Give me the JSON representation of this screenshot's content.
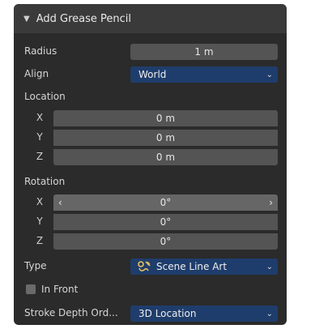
{
  "panel": {
    "title": "Add Grease Pencil",
    "collapse_glyph": "▼"
  },
  "radius": {
    "label": "Radius",
    "value": "1 m"
  },
  "align": {
    "label": "Align",
    "value": "World"
  },
  "location": {
    "label": "Location",
    "x_label": "X",
    "x_value": "0 m",
    "y_label": "Y",
    "y_value": "0 m",
    "z_label": "Z",
    "z_value": "0 m"
  },
  "rotation": {
    "label": "Rotation",
    "x_label": "X",
    "x_value": "0°",
    "y_label": "Y",
    "y_value": "0°",
    "z_label": "Z",
    "z_value": "0°",
    "left_arrow": "‹",
    "right_arrow": "›"
  },
  "type": {
    "label": "Type",
    "value": "Scene Line Art",
    "icon": "grease-pencil-line-art-icon"
  },
  "in_front": {
    "label": "In Front",
    "checked": false
  },
  "stroke_depth": {
    "label": "Stroke Depth Ord...",
    "value": "3D Location"
  },
  "glyphs": {
    "chevron": "⌄"
  },
  "colors": {
    "panel_bg": "#2b2b2b",
    "header_bg": "#3a3a3a",
    "field_bg": "#545454",
    "dropdown_bg": "#1f3d6c",
    "icon_yellow": "#e6c15a"
  }
}
